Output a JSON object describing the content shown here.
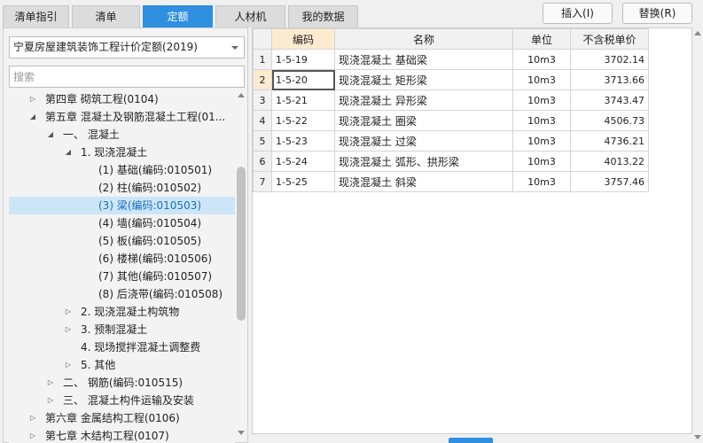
{
  "tabs": [
    {
      "label": "清单指引",
      "active": false
    },
    {
      "label": "清单",
      "active": false
    },
    {
      "label": "定额",
      "active": true
    },
    {
      "label": "人材机",
      "active": false
    },
    {
      "label": "我的数据",
      "active": false
    }
  ],
  "buttons": {
    "insert": "插入(I)",
    "replace": "替换(R)"
  },
  "library_select": {
    "value": "宁夏房屋建筑装饰工程计价定额(2019)"
  },
  "search": {
    "placeholder": "搜索"
  },
  "tree": [
    {
      "label": "第四章 砌筑工程(0104)",
      "arrow": "▷",
      "level": 0
    },
    {
      "label": "第五章 混凝土及钢筋混凝土工程(01...",
      "arrow": "◢",
      "level": 0
    },
    {
      "label": "一、 混凝土",
      "arrow": "◢",
      "level": 1
    },
    {
      "label": "1. 现浇混凝土",
      "arrow": "◢",
      "level": 2
    },
    {
      "label": "(1) 基础(编码:010501)",
      "arrow": "",
      "level": 3
    },
    {
      "label": "(2) 柱(编码:010502)",
      "arrow": "",
      "level": 3
    },
    {
      "label": "(3) 梁(编码:010503)",
      "arrow": "",
      "level": 3,
      "selected": true
    },
    {
      "label": "(4) 墙(编码:010504)",
      "arrow": "",
      "level": 3
    },
    {
      "label": "(5) 板(编码:010505)",
      "arrow": "",
      "level": 3
    },
    {
      "label": "(6) 楼梯(编码:010506)",
      "arrow": "",
      "level": 3
    },
    {
      "label": "(7) 其他(编码:010507)",
      "arrow": "",
      "level": 3
    },
    {
      "label": "(8) 后浇带(编码:010508)",
      "arrow": "",
      "level": 3
    },
    {
      "label": "2. 现浇混凝土构筑物",
      "arrow": "▷",
      "level": 2
    },
    {
      "label": "3. 预制混凝土",
      "arrow": "▷",
      "level": 2
    },
    {
      "label": "4. 现场搅拌混凝土调整费",
      "arrow": "",
      "level": 2
    },
    {
      "label": "5. 其他",
      "arrow": "▷",
      "level": 2
    },
    {
      "label": "二、 钢筋(编码:010515)",
      "arrow": "▷",
      "level": 1
    },
    {
      "label": "三、 混凝土构件运输及安装",
      "arrow": "▷",
      "level": 1
    },
    {
      "label": "第六章 金属结构工程(0106)",
      "arrow": "▷",
      "level": 0
    },
    {
      "label": "第七章 木结构工程(0107)",
      "arrow": "▷",
      "level": 0
    }
  ],
  "grid": {
    "columns": [
      "编码",
      "名称",
      "单位",
      "不含税单价"
    ],
    "rows": [
      {
        "index": "1",
        "code": "1-5-19",
        "name": "现浇混凝土 基础梁",
        "unit": "10m3",
        "price": "3702.14"
      },
      {
        "index": "2",
        "code": "1-5-20",
        "name": "现浇混凝土 矩形梁",
        "unit": "10m3",
        "price": "3713.66"
      },
      {
        "index": "3",
        "code": "1-5-21",
        "name": "现浇混凝土 异形梁",
        "unit": "10m3",
        "price": "3743.47"
      },
      {
        "index": "4",
        "code": "1-5-22",
        "name": "现浇混凝土 圈梁",
        "unit": "10m3",
        "price": "4506.73"
      },
      {
        "index": "5",
        "code": "1-5-23",
        "name": "现浇混凝土 过梁",
        "unit": "10m3",
        "price": "4736.21"
      },
      {
        "index": "6",
        "code": "1-5-24",
        "name": "现浇混凝土 弧形、拱形梁",
        "unit": "10m3",
        "price": "4013.22"
      },
      {
        "index": "7",
        "code": "1-5-25",
        "name": "现浇混凝土 斜梁",
        "unit": "10m3",
        "price": "3757.46"
      }
    ],
    "selected_row": "2"
  },
  "colors": {
    "accent": "#2f8fe0",
    "header_highlight": "#fdebd0",
    "tree_selected": "#cde6f7"
  }
}
